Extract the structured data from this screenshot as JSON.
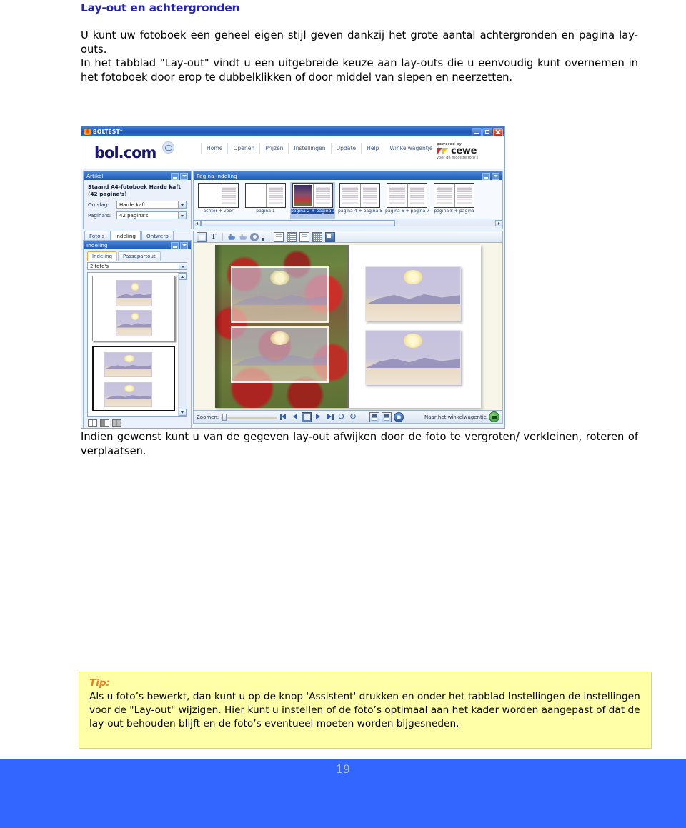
{
  "document": {
    "heading": "Lay-out en achtergronden",
    "paragraph1": "U kunt uw fotoboek een geheel eigen stijl geven dankzij het grote aantal achtergronden en pagina lay-outs.",
    "paragraph2": "In het tabblad \"Lay-out\" vindt u een uitgebreide keuze aan lay-outs die u eenvoudig kunt overnemen in het fotoboek door erop te dubbelklikken of door middel van slepen en neerzetten.",
    "paragraph3": "Indien gewenst kunt u van de gegeven lay-out afwijken door de foto te vergroten/ verkleinen, roteren of verplaatsen.",
    "page_number": "19"
  },
  "tip": {
    "label": "Tip:",
    "body": "Als u foto’s bewerkt, dan kunt u op de knop 'Assistent' drukken en onder het tabblad Instellingen de instellingen voor de \"Lay-out\" wijzigen. Hier kunt u instellen of de foto’s optimaal aan het kader worden aangepast of dat de lay-out behouden blijft en de foto’s eventueel moeten worden bijgesneden."
  },
  "app": {
    "titlebar": {
      "title": "BOLTEST*",
      "icon": "app-icon",
      "minimize": "minimize-icon",
      "maximize": "maximize-icon",
      "close": "close-icon"
    },
    "brand": {
      "logo_text": "bol.com",
      "powered_by": "powered by",
      "partner_name": "cewe",
      "partner_tagline": "voor de mooiste foto's"
    },
    "nav": [
      "Home",
      "Openen",
      "Prijzen",
      "Instellingen",
      "Update",
      "Help",
      "Winkelwagentje"
    ],
    "artikel_panel": {
      "title": "Artikel",
      "product_line1": "Staand A4-fotoboek Harde kaft",
      "product_line2": "(42 pagina's)",
      "fields": [
        {
          "label": "Omslag:",
          "value": "Harde kaft"
        },
        {
          "label": "Pagina's:",
          "value": "42 pagina's"
        }
      ]
    },
    "pagina_panel": {
      "title": "Pagina-indeling",
      "thumbs": [
        {
          "label": "achter + voor",
          "kind": "cover",
          "selected": false
        },
        {
          "label": "pagina 1",
          "kind": "single",
          "selected": false
        },
        {
          "label": "pagina 2 + pagina 3",
          "kind": "photo",
          "selected": true
        },
        {
          "label": "pagina 4 + pagina 5",
          "kind": "text",
          "selected": false
        },
        {
          "label": "pagina 6 + pagina 7",
          "kind": "text",
          "selected": false
        },
        {
          "label": "pagina 8 + pagina",
          "kind": "text",
          "selected": false
        }
      ]
    },
    "left_tabs": [
      {
        "label": "Foto's",
        "active": false
      },
      {
        "label": "Indeling",
        "active": true
      },
      {
        "label": "Ontwerp",
        "active": false
      }
    ],
    "indeling_panel": {
      "title": "Indeling",
      "subtabs": [
        {
          "label": "Indeling",
          "active": true
        },
        {
          "label": "Passepartout",
          "active": false
        }
      ],
      "filter_value": "2 foto's"
    },
    "pageview_buttons": [
      "page-view-single",
      "page-view-spread",
      "page-view-double"
    ],
    "toolbar_icons": [
      "frame-icon",
      "text-icon",
      "hand-icon",
      "arrow-icon",
      "effects-icon",
      "dropdown-arrow-icon",
      "add-page-icon",
      "layout-icon",
      "copy-page-icon",
      "grid-icon",
      "magnify-icon"
    ],
    "statusbar": {
      "zoom_label": "Zoomen:",
      "nav_icons": [
        "first-page-icon",
        "previous-page-icon",
        "book-view-icon",
        "next-page-icon",
        "last-page-icon",
        "rotate-left-icon",
        "rotate-right-icon"
      ],
      "save_icons": [
        "save-icon",
        "save-as-icon",
        "order-status-icon"
      ],
      "cart_label": "Naar het winkelwagentje",
      "cart_icon": "shopping-cart-icon"
    }
  }
}
